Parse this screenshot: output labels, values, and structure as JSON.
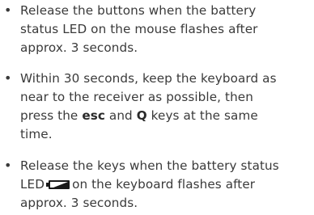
{
  "instructions": [
    {
      "lines": [
        "Release the buttons when the battery",
        "status LED on the mouse flashes after",
        "approx. 3 seconds."
      ]
    },
    {
      "lines_before": [
        "Within 30 seconds, keep the keyboard as",
        "near to the receiver as possible, then"
      ],
      "press_text": "press the",
      "key1": "esc",
      "and_text": "and",
      "key2": "Q",
      "after_keys": "keys at the same",
      "last_line": "time."
    },
    {
      "line1": "Release the keys when the battery status",
      "led_label": "LED",
      "led_after": "on the keyboard flashes after",
      "line3": "approx. 3 seconds.",
      "icon": "battery-status-icon"
    }
  ]
}
